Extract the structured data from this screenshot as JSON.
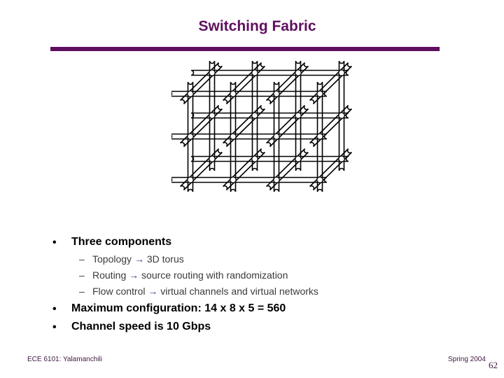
{
  "slide": {
    "title": "Switching Fabric",
    "accent_color": "#5f0f5f",
    "diagram": {
      "name": "3D torus topology",
      "layers": 2,
      "columns": 4,
      "rows": 3
    },
    "bullets": [
      {
        "text": "Three components",
        "sub_items": [
          {
            "label": "Topology",
            "arrow": "→",
            "detail": "3D torus"
          },
          {
            "label": "Routing",
            "arrow": "→",
            "detail": "source routing with randomization"
          },
          {
            "label": "Flow control",
            "arrow": "→",
            "detail": "virtual channels and virtual networks"
          }
        ]
      },
      {
        "text": "Maximum configuration: 14 x 8 x 5 = 560"
      },
      {
        "text": "Channel speed is 10 Gbps"
      }
    ],
    "bullet_glyph": "•",
    "dash_glyph": "–"
  },
  "footer": {
    "left": "ECE 6101: Yalamanchili",
    "right": "Spring 2004",
    "page_number": "62"
  }
}
